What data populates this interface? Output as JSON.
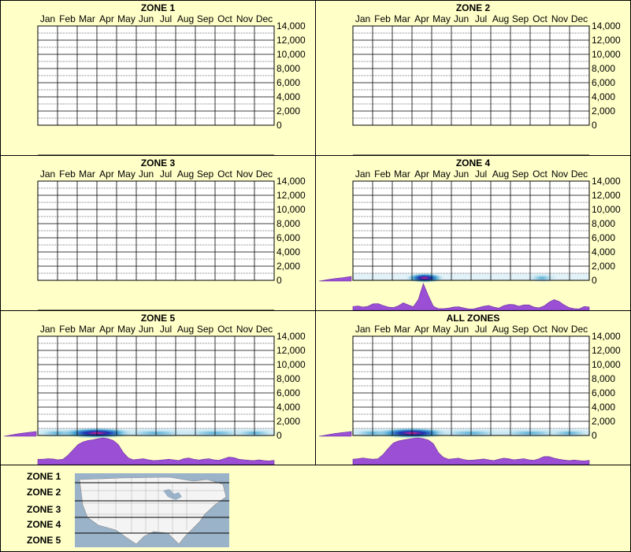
{
  "months": [
    "Jan",
    "Feb",
    "Mar",
    "Apr",
    "May",
    "Jun",
    "Jul",
    "Aug",
    "Sep",
    "Oct",
    "Nov",
    "Dec"
  ],
  "y_ticks": [
    "14,000",
    "12,000",
    "10,000",
    "8,000",
    "6,000",
    "4,000",
    "2,000",
    "0"
  ],
  "colors": {
    "background": "#ffffc8",
    "profile": "#9b4fd4",
    "profile_edge": "#6a2fa0",
    "heat_low": "#bfe3f0",
    "heat_mid": "#3aa0d0",
    "heat_high": "#1a2fb0",
    "heat_peak": "#e0208a"
  },
  "chart_data": [
    {
      "type": "heatmap",
      "title": "ZONE 1",
      "x_categories": [
        "Jan",
        "Feb",
        "Mar",
        "Apr",
        "May",
        "Jun",
        "Jul",
        "Aug",
        "Sep",
        "Oct",
        "Nov",
        "Dec"
      ],
      "ylim": [
        0,
        14000
      ],
      "has_data": false,
      "altitude_distribution": [],
      "monthly_distribution": []
    },
    {
      "type": "heatmap",
      "title": "ZONE 2",
      "x_categories": [
        "Jan",
        "Feb",
        "Mar",
        "Apr",
        "May",
        "Jun",
        "Jul",
        "Aug",
        "Sep",
        "Oct",
        "Nov",
        "Dec"
      ],
      "ylim": [
        0,
        14000
      ],
      "has_data": false,
      "altitude_distribution": [],
      "monthly_distribution": []
    },
    {
      "type": "heatmap",
      "title": "ZONE 3",
      "x_categories": [
        "Jan",
        "Feb",
        "Mar",
        "Apr",
        "May",
        "Jun",
        "Jul",
        "Aug",
        "Sep",
        "Oct",
        "Nov",
        "Dec"
      ],
      "ylim": [
        0,
        14000
      ],
      "has_data": false,
      "altitude_distribution": [],
      "monthly_distribution": []
    },
    {
      "type": "heatmap",
      "title": "ZONE 4",
      "x_categories": [
        "Jan",
        "Feb",
        "Mar",
        "Apr",
        "May",
        "Jun",
        "Jul",
        "Aug",
        "Sep",
        "Oct",
        "Nov",
        "Dec"
      ],
      "ylim": [
        0,
        14000
      ],
      "has_data": true,
      "altitude_distribution": [
        0.0,
        0.3,
        0.55,
        0.75,
        1.0
      ],
      "monthly_distribution": [
        0.14,
        0.16,
        0.12,
        0.15,
        0.24,
        0.25,
        0.18,
        0.12,
        0.1,
        0.16,
        0.28,
        0.2,
        0.13,
        0.4,
        1.0,
        0.55,
        0.15,
        0.06,
        0.06,
        0.08,
        0.12,
        0.13,
        0.09,
        0.05,
        0.05,
        0.1,
        0.15,
        0.18,
        0.12,
        0.08,
        0.17,
        0.22,
        0.21,
        0.15,
        0.2,
        0.2,
        0.12,
        0.09,
        0.16,
        0.3,
        0.4,
        0.33,
        0.2,
        0.1,
        0.06,
        0.05,
        0.14,
        0.12
      ],
      "heat_spots": [
        {
          "month": 4.15,
          "spread": 0.45,
          "intensity": 0.75
        },
        {
          "month": 10.1,
          "spread": 0.35,
          "intensity": 0.3
        }
      ]
    },
    {
      "type": "heatmap",
      "title": "ZONE 5",
      "x_categories": [
        "Jan",
        "Feb",
        "Mar",
        "Apr",
        "May",
        "Jun",
        "Jul",
        "Aug",
        "Sep",
        "Oct",
        "Nov",
        "Dec"
      ],
      "ylim": [
        0,
        14000
      ],
      "has_data": true,
      "altitude_distribution": [
        0.0,
        0.3,
        0.6,
        0.8,
        1.0
      ],
      "monthly_distribution": [
        0.2,
        0.2,
        0.22,
        0.21,
        0.18,
        0.2,
        0.35,
        0.55,
        0.75,
        0.85,
        0.9,
        0.93,
        0.97,
        1.0,
        0.97,
        0.9,
        0.75,
        0.45,
        0.25,
        0.18,
        0.2,
        0.22,
        0.18,
        0.15,
        0.16,
        0.18,
        0.2,
        0.18,
        0.15,
        0.22,
        0.25,
        0.2,
        0.17,
        0.2,
        0.22,
        0.18,
        0.16,
        0.22,
        0.28,
        0.26,
        0.2,
        0.18,
        0.16,
        0.15,
        0.18,
        0.15,
        0.14,
        0.16
      ],
      "heat_spots": [
        {
          "month": 1.5,
          "spread": 0.6,
          "intensity": 0.35
        },
        {
          "month": 3.5,
          "spread": 0.9,
          "intensity": 1.0
        },
        {
          "month": 6.5,
          "spread": 0.9,
          "intensity": 0.35
        },
        {
          "month": 9.5,
          "spread": 0.9,
          "intensity": 0.3
        },
        {
          "month": 11.5,
          "spread": 0.6,
          "intensity": 0.3
        }
      ]
    },
    {
      "type": "heatmap",
      "title": "ALL ZONES",
      "x_categories": [
        "Jan",
        "Feb",
        "Mar",
        "Apr",
        "May",
        "Jun",
        "Jul",
        "Aug",
        "Sep",
        "Oct",
        "Nov",
        "Dec"
      ],
      "ylim": [
        0,
        14000
      ],
      "has_data": true,
      "altitude_distribution": [
        0.0,
        0.3,
        0.6,
        0.8,
        1.0
      ],
      "monthly_distribution": [
        0.2,
        0.22,
        0.25,
        0.22,
        0.2,
        0.22,
        0.38,
        0.6,
        0.8,
        0.88,
        0.92,
        0.95,
        0.98,
        1.0,
        0.97,
        0.92,
        0.78,
        0.45,
        0.27,
        0.2,
        0.22,
        0.24,
        0.19,
        0.16,
        0.17,
        0.19,
        0.21,
        0.18,
        0.15,
        0.2,
        0.24,
        0.22,
        0.18,
        0.2,
        0.22,
        0.18,
        0.16,
        0.22,
        0.3,
        0.3,
        0.24,
        0.2,
        0.17,
        0.15,
        0.17,
        0.15,
        0.14,
        0.16
      ],
      "heat_spots": [
        {
          "month": 1.5,
          "spread": 0.6,
          "intensity": 0.35
        },
        {
          "month": 3.5,
          "spread": 0.9,
          "intensity": 1.0
        },
        {
          "month": 6.5,
          "spread": 0.9,
          "intensity": 0.35
        },
        {
          "month": 9.5,
          "spread": 0.9,
          "intensity": 0.35
        },
        {
          "month": 11.5,
          "spread": 0.6,
          "intensity": 0.3
        }
      ]
    }
  ],
  "legend": {
    "zones": [
      "ZONE 1",
      "ZONE 2",
      "ZONE 3",
      "ZONE 4",
      "ZONE 5"
    ]
  }
}
